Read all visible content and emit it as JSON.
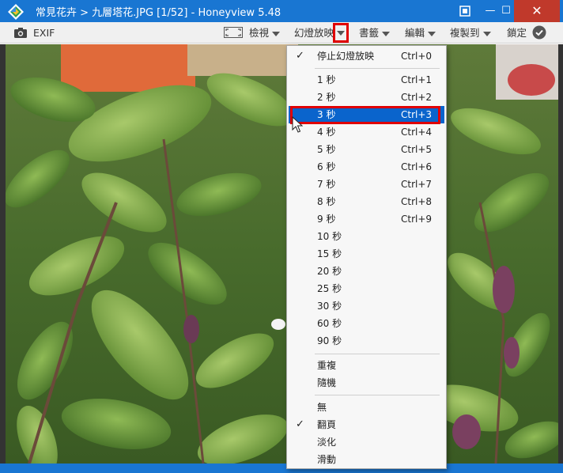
{
  "titlebar": {
    "title": "常見花卉 > 九層塔花.JPG [1/52] - Honeyview 5.48",
    "logo_icon": "honeyview-logo-icon",
    "fit_icon": "fit-window-icon",
    "minimize_label": "—",
    "maximize_label": "☐",
    "close_label": "✕"
  },
  "toolbar": {
    "exif_label": "EXIF",
    "view_label": "檢視",
    "slideshow_label": "幻燈放映",
    "bookmark_label": "書籤",
    "edit_label": "編輯",
    "copyto_label": "複製到",
    "lock_label": "鎖定"
  },
  "menu": {
    "stop_label": "停止幻燈放映",
    "stop_shortcut": "Ctrl+0",
    "intervals": [
      {
        "label": "1 秒",
        "shortcut": "Ctrl+1"
      },
      {
        "label": "2 秒",
        "shortcut": "Ctrl+2"
      },
      {
        "label": "3 秒",
        "shortcut": "Ctrl+3"
      },
      {
        "label": "4 秒",
        "shortcut": "Ctrl+4"
      },
      {
        "label": "5 秒",
        "shortcut": "Ctrl+5"
      },
      {
        "label": "6 秒",
        "shortcut": "Ctrl+6"
      },
      {
        "label": "7 秒",
        "shortcut": "Ctrl+7"
      },
      {
        "label": "8 秒",
        "shortcut": "Ctrl+8"
      },
      {
        "label": "9 秒",
        "shortcut": "Ctrl+9"
      },
      {
        "label": "10 秒",
        "shortcut": ""
      },
      {
        "label": "15 秒",
        "shortcut": ""
      },
      {
        "label": "20 秒",
        "shortcut": ""
      },
      {
        "label": "25 秒",
        "shortcut": ""
      },
      {
        "label": "30 秒",
        "shortcut": ""
      },
      {
        "label": "60 秒",
        "shortcut": ""
      },
      {
        "label": "90 秒",
        "shortcut": ""
      }
    ],
    "repeat_label": "重複",
    "random_label": "隨機",
    "transitions": [
      {
        "label": "無"
      },
      {
        "label": "翻頁"
      },
      {
        "label": "淡化"
      },
      {
        "label": "滑動"
      }
    ],
    "check_mark": "✓"
  },
  "colors": {
    "titlebar": "#1976d2",
    "highlight": "#0a64cc",
    "annotation": "#e00000"
  }
}
